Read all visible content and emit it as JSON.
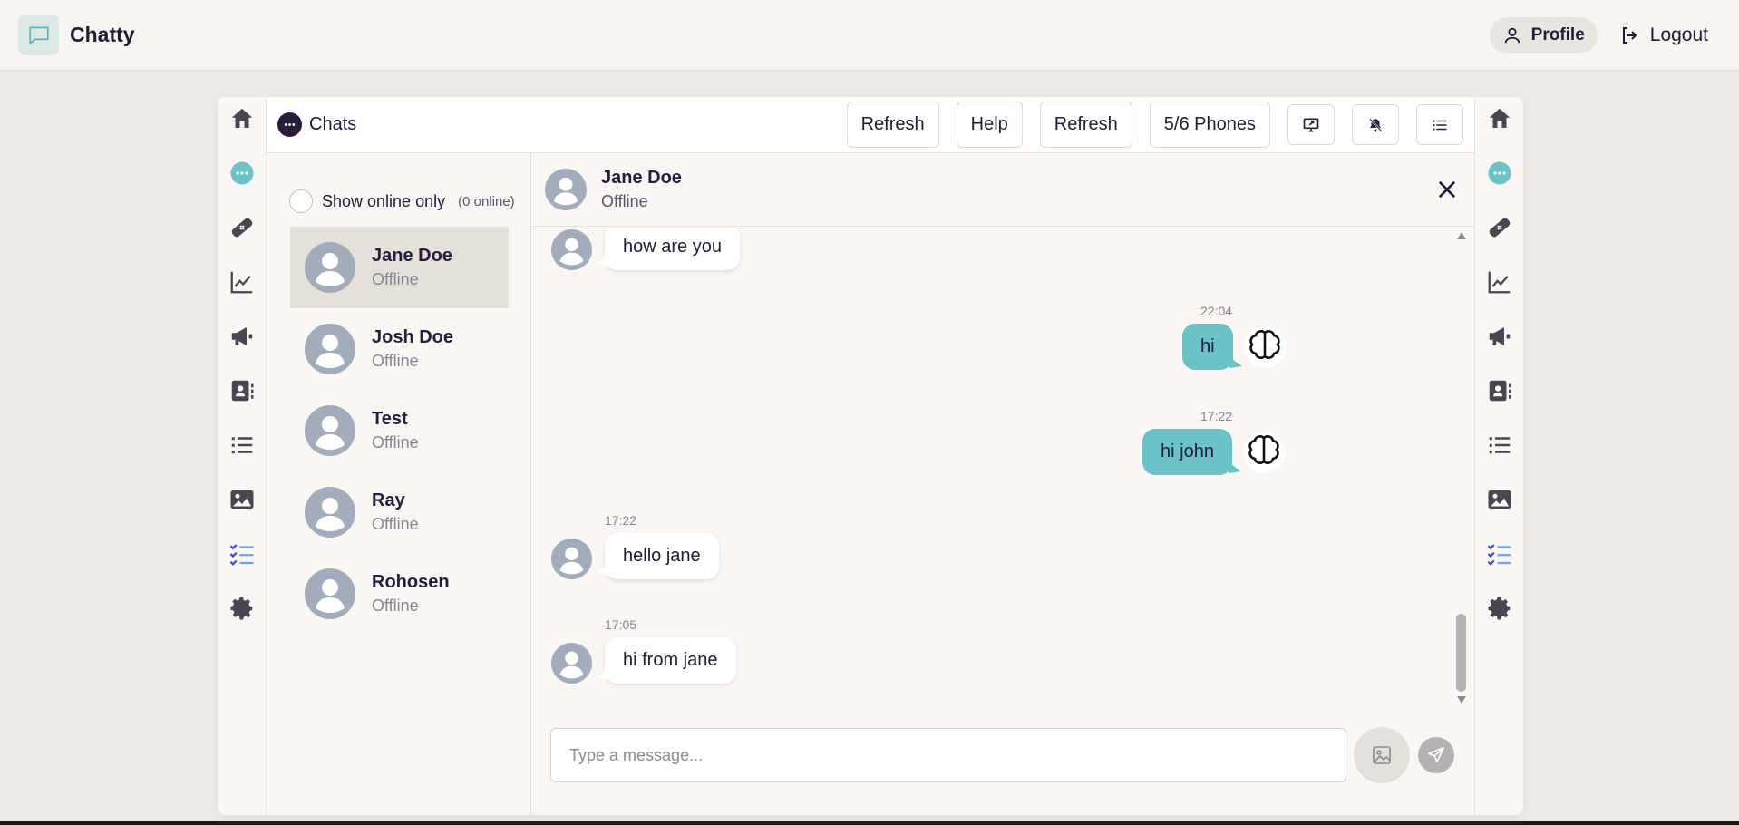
{
  "app": {
    "name": "Chatty"
  },
  "navbar": {
    "profile_label": "Profile",
    "logout_label": "Logout"
  },
  "rail_icons": [
    "home-icon",
    "chat-icon",
    "bandage-icon",
    "chart-line-icon",
    "megaphone-icon",
    "address-book-icon",
    "list-icon",
    "image-icon",
    "checklist-icon",
    "gear-icon"
  ],
  "topbar": {
    "title": "Chats",
    "buttons": [
      "Refresh",
      "Help",
      "Refresh",
      "5/6 Phones"
    ]
  },
  "contacts": {
    "online_only_label": "Show online only",
    "online_count": "(0 online)",
    "items": [
      {
        "name": "Jane Doe",
        "status": "Offline"
      },
      {
        "name": "Josh Doe",
        "status": "Offline"
      },
      {
        "name": "Test",
        "status": "Offline"
      },
      {
        "name": "Ray",
        "status": "Offline"
      },
      {
        "name": "Rohosen",
        "status": "Offline"
      }
    ]
  },
  "chat": {
    "contact_name": "Jane Doe",
    "contact_status": "Offline",
    "messages": [
      {
        "direction": "in",
        "text": "how are you"
      },
      {
        "direction": "out",
        "time": "22:04",
        "text": "hi"
      },
      {
        "direction": "out",
        "time": "17:22",
        "text": "hi john"
      },
      {
        "direction": "in",
        "time": "17:22",
        "text": "hello jane"
      },
      {
        "direction": "in",
        "time": "17:05",
        "text": "hi from jane"
      }
    ],
    "input_placeholder": "Type a message..."
  },
  "colors": {
    "accent": "#6cc3c7",
    "brand_dark": "#2a1b3d",
    "bubble_in": "#ffffff"
  }
}
